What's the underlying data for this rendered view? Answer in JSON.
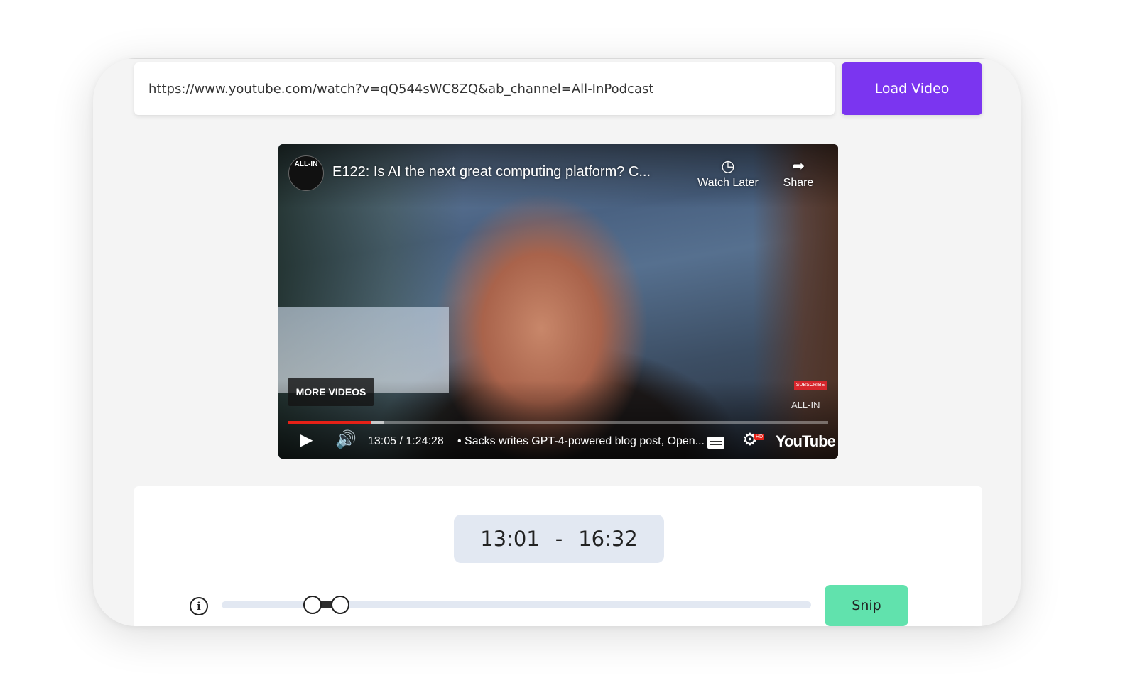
{
  "url_bar": {
    "value": "https://www.youtube.com/watch?v=qQ544sWC8ZQ&ab_channel=All-InPodcast",
    "load_label": "Load Video",
    "accent_color": "#7b35f0"
  },
  "player": {
    "channel_avatar_text": "ALL-IN",
    "title": "E122: Is AI the next great computing platform? C...",
    "watch_later_label": "Watch Later",
    "share_label": "Share",
    "more_videos_label": "MORE VIDEOS",
    "subscribe_label": "SUBSCRIBE",
    "watermark": "ALL-IN",
    "time_display": "13:05 / 1:24:28",
    "chapter": "• Sacks writes GPT-4-powered blog post, Open...",
    "hd_badge": "HD",
    "logo": "YouTube",
    "progress": 0.154
  },
  "snipper": {
    "start": "13:01",
    "separator": "-",
    "end": "16:32",
    "range_start_fraction": 0.154,
    "range_end_fraction": 0.196,
    "snip_label": "Snip",
    "snip_color": "#61e2ad"
  }
}
